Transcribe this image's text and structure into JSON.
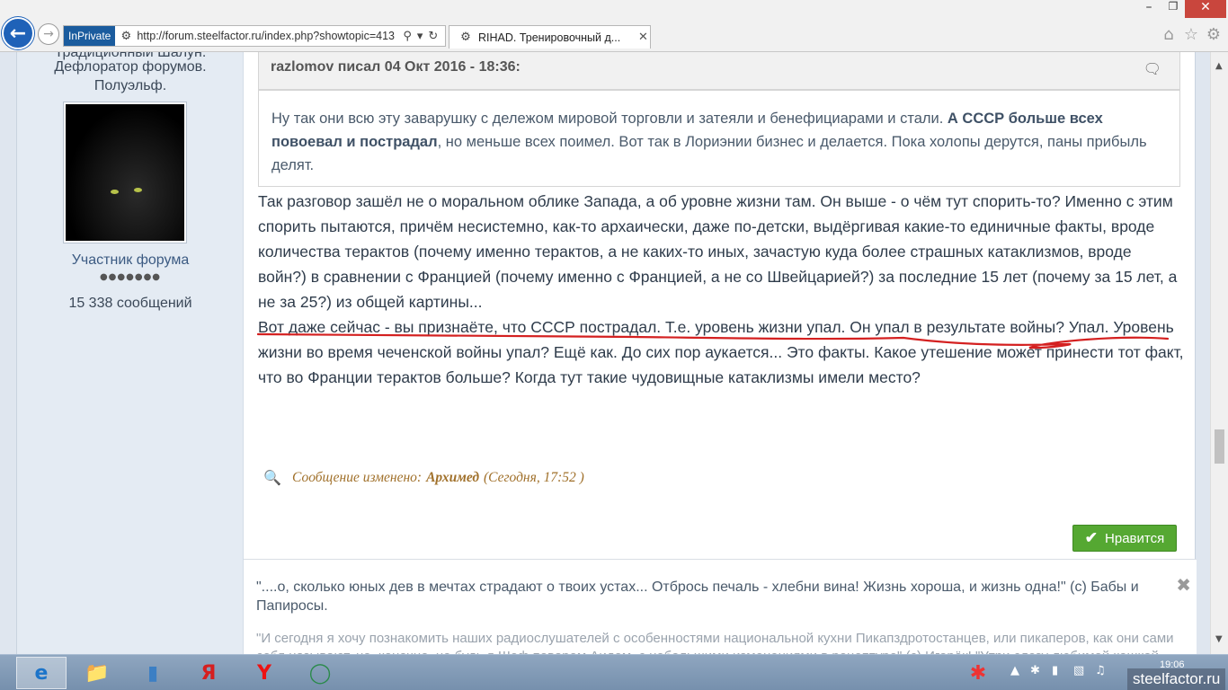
{
  "browser": {
    "inprivate_label": "InPrivate",
    "url": "http://forum.steelfactor.ru/index.php?showtopic=413",
    "tab_title": "RIHAD. Тренировочный д...",
    "icons": [
      "back-icon",
      "forward-icon",
      "search-icon",
      "dropdown-icon",
      "refresh-icon",
      "home-icon",
      "favorites-icon",
      "settings-icon"
    ]
  },
  "author": {
    "title_line1": "Традиционный Шалун.",
    "title_line2": "Дефлоратор форумов.",
    "title_line3": "Полуэльф.",
    "group": "Участник форума",
    "pips": "●●●●●●●",
    "posts": "15 338 сообщений"
  },
  "quote": {
    "cite": "razlomov писал 04 Окт 2016 - 18:36:",
    "text_before": "Ну так они всю эту заварушку с дележом мировой торговли и затеяли и бенефициарами и стали. ",
    "text_bold": "А СССР больше всех повоевал и пострадал",
    "text_after": ", но меньше всех поимел. Вот так в Лориэнии бизнес и делается. Пока холопы дерутся, паны прибыль делят."
  },
  "post": {
    "paragraph1": "Так разговор зашёл не о моральном облике Запада, а об уровне жизни там. Он выше - о чём тут спорить-то? Именно с этим спорить пытаются, причём несистемно, как-то архаически, даже по-детски, выдёргивая какие-то единичные факты, вроде количества терактов (почему именно терактов, а не каких-то иных, зачастую куда более страшных катаклизмов, вроде войн?) в сравнении с Францией (почему именно с Францией, а не со Швейцарией?) за последние 15 лет (почему за 15 лет, а не за 25?) из общей картины...",
    "paragraph2": "Вот даже сейчас - вы признаёте, что СССР пострадал. Т.е. уровень жизни упал. Он упал в результате войны? Упал. Уровень жизни во время чеченской войны упал? Ещё как. До сих пор аукается... Это факты. Какое утешение может принести тот факт, что во Франции терактов больше? Когда тут такие чудовищные катаклизмы имели место?",
    "underline_color": "#d42020"
  },
  "edit": {
    "prefix": "Сообщение изменено:",
    "user": "Архимед",
    "time": "(Сегодня, 17:52 )"
  },
  "like": {
    "label": "Нравится",
    "color": "#55a832"
  },
  "signature": {
    "main": "\"....о, сколько юных дев в мечтах страдают о твоих устах... Отбрось печаль - хлебни вина! Жизнь хороша, и жизнь одна!\" (с) Бабы и Папиросы.",
    "extra": "\"И сегодня я хочу познакомить наших радиослушателей с  особенностями национальной кухни Пикапздротостанцев, или пикаперов, как они сами себя называют, но, конечно,  не будь я Шеф поваром Аидом, с небольшими изменениями в рецептуре\" (с) Игорёк! \"Утри слезу любимой кошкой, прочти запоем \"Манифест\", хлебни вина, подрыгай ножкой, на"
  },
  "taskbar": {
    "clock": "19:06",
    "watermark": "steelfactor.ru"
  }
}
